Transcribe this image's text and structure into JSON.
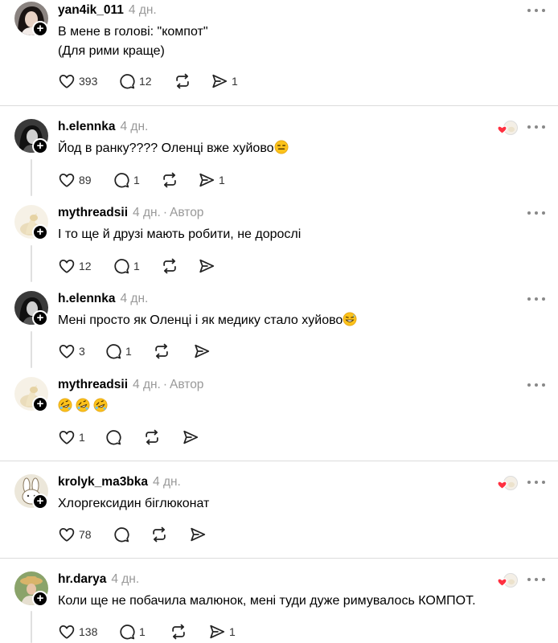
{
  "posts": [
    {
      "username": "yan4ik_011",
      "time": "4 дн.",
      "author_label": "",
      "lines": [
        "В мене в голові: \"компот\"",
        "(Для рими краще)"
      ],
      "likes": "393",
      "replies": "12",
      "reposts": "",
      "shares": "1"
    },
    {
      "username": "h.elennka",
      "time": "4 дн.",
      "author_label": "",
      "lines": [
        "Йод в ранку???? Оленці вже хуйово"
      ],
      "likes": "89",
      "replies": "1",
      "reposts": "",
      "shares": "1"
    },
    {
      "username": "mythreadsii",
      "time": "4 дн.",
      "author_label": "Автор",
      "lines": [
        "І то ще й друзі мають робити, не дорослі"
      ],
      "likes": "12",
      "replies": "1",
      "reposts": "",
      "shares": ""
    },
    {
      "username": "h.elennka",
      "time": "4 дн.",
      "author_label": "",
      "lines": [
        "Мені просто як Оленці і як медику стало хуйово"
      ],
      "likes": "3",
      "replies": "1",
      "reposts": "",
      "shares": ""
    },
    {
      "username": "mythreadsii",
      "time": "4 дн.",
      "author_label": "Автор",
      "lines": [
        ""
      ],
      "likes": "1",
      "replies": "",
      "reposts": "",
      "shares": ""
    },
    {
      "username": "krolyk_ma3bka",
      "time": "4 дн.",
      "author_label": "",
      "lines": [
        "Хлоргексидин біглюконат"
      ],
      "likes": "78",
      "replies": "",
      "reposts": "",
      "shares": ""
    },
    {
      "username": "hr.darya",
      "time": "4 дн.",
      "author_label": "",
      "lines": [
        "Коли ще не побачила малюнок, мені туди дуже римувалось КОМПОТ."
      ],
      "likes": "138",
      "replies": "1",
      "reposts": "",
      "shares": "1"
    }
  ],
  "ui": {
    "separator": "·",
    "plus": "+"
  },
  "icons": {
    "like": "heart-outline-icon",
    "reply": "comment-bubble-icon",
    "repost": "repost-arrows-icon",
    "share": "send-icon",
    "more": "more-dots-icon",
    "liked_by_author": "liked-by-author-icon",
    "follow": "plus-icon"
  },
  "colors": {
    "text": "#000000",
    "muted": "#999999",
    "divider": "#dcdcdc",
    "heart": "#ff3040"
  }
}
